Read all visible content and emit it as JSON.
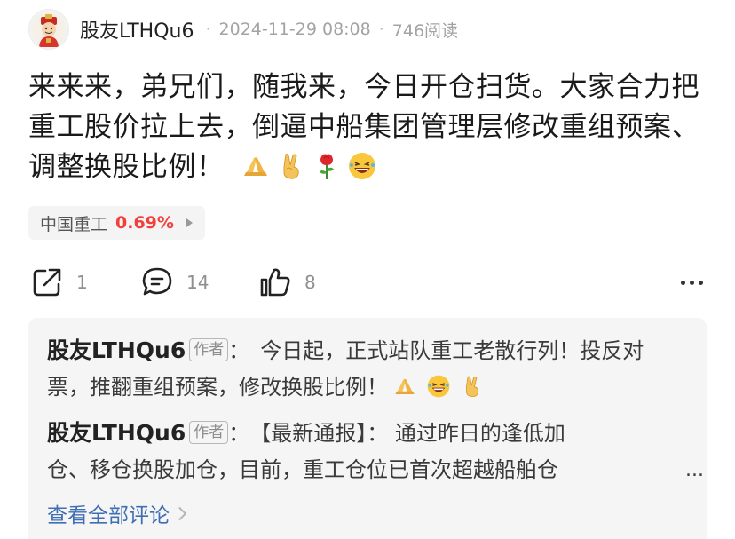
{
  "post": {
    "author": "股友LTHQu6",
    "date": "2024-11-29 08:08",
    "views": "746阅读",
    "text": "来来来，弟兄们，随我来，今日开仓扫货。大家合力把重工股价拉上去，倒逼中船集团管理层修改重组预案、调整换股比例！",
    "emojis": [
      "pray-hands-emoji",
      "victory-hand-emoji",
      "rose-emoji",
      "laughing-face-emoji"
    ]
  },
  "stock": {
    "name": "中国重工",
    "change": "0.69%",
    "change_color": "#f0413c"
  },
  "actions": {
    "share_count": "1",
    "comment_count": "14",
    "like_count": "8"
  },
  "comments": [
    {
      "author": "股友LTHQu6",
      "tag": "作者",
      "text_before": "今日起，正式站队重工老散行列！投反对票，推翻重组预案，修改换股比例！",
      "emojis": [
        "pray-hands-emoji",
        "laughing-face-emoji",
        "victory-hand-emoji"
      ]
    },
    {
      "author": "股友LTHQu6",
      "tag": "作者",
      "text_line1": "【最新通报】： 通过昨日的逢低加",
      "text_line2": "仓、移仓换股加仓，目前，重工仓位已首次超越船舶仓",
      "ellipsis": "..."
    }
  ],
  "view_all_label": "查看全部评论",
  "colors": {
    "link": "#3f6fb2",
    "comment_bg": "#f5f5f6",
    "muted": "#a3a3a3"
  }
}
